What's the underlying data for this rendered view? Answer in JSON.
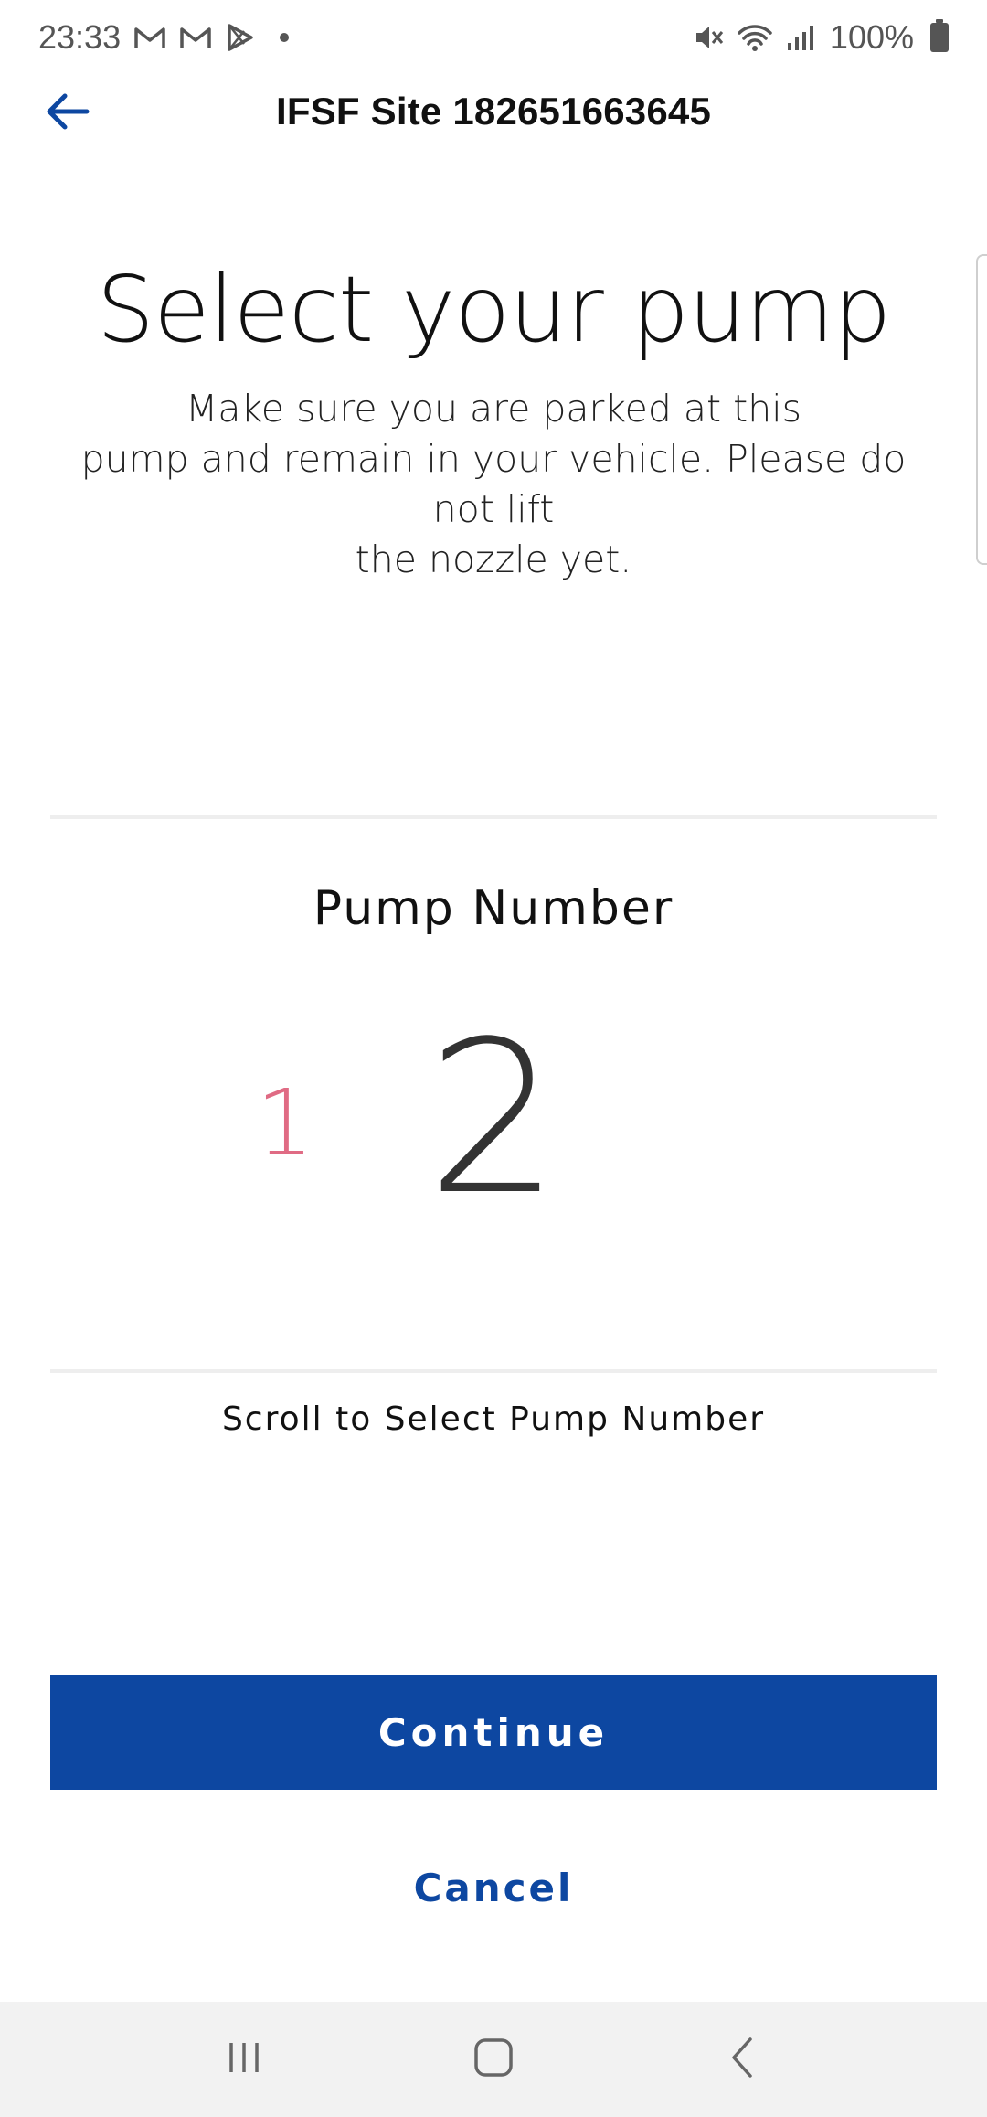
{
  "status_bar": {
    "time": "23:33",
    "battery": "100%",
    "icons": [
      "gmail-icon",
      "gmail-icon",
      "play-store-icon",
      "notification-dot",
      "mute-icon",
      "wifi-icon",
      "signal-icon",
      "battery-icon"
    ]
  },
  "app_bar": {
    "title": "IFSF Site 182651663645",
    "back_icon": "arrow-left-icon"
  },
  "main": {
    "heading": "Select your pump",
    "subtext_line1": "Make sure you are parked at this",
    "subtext_line2": "pump and remain in your vehicle. Please do not lift",
    "subtext_line3": "the nozzle yet."
  },
  "picker": {
    "label": "Pump Number",
    "previous_value": "1",
    "selected_value": "2",
    "hint": "Scroll to Select Pump Number"
  },
  "actions": {
    "continue_label": "Continue",
    "cancel_label": "Cancel"
  },
  "nav_bar": {
    "icons": [
      "recent-apps-icon",
      "home-icon",
      "back-icon"
    ]
  },
  "colors": {
    "accent": "#0d47a1",
    "picker_prev": "#e06b84",
    "nav_background": "#f2f2f2"
  }
}
